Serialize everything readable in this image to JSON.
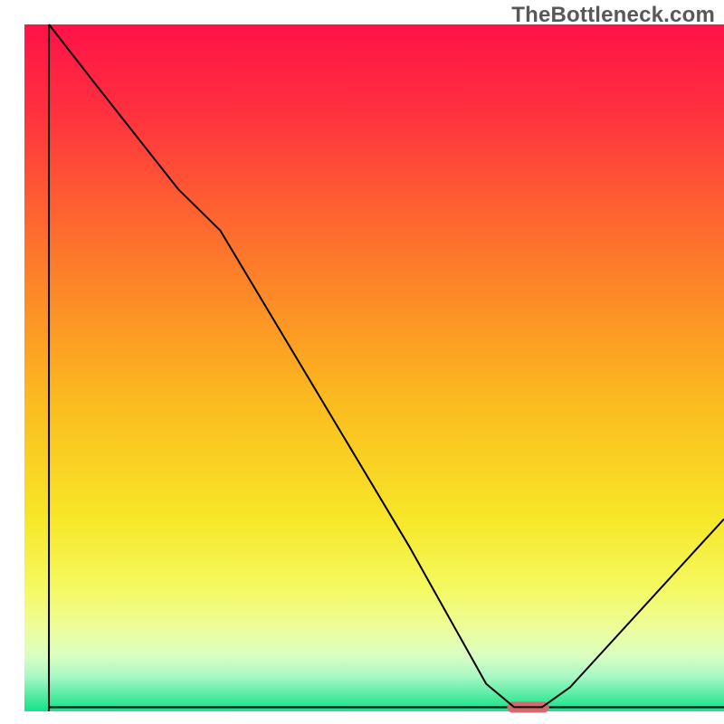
{
  "watermark": "TheBottleneck.com",
  "chart_data": {
    "type": "line",
    "title": "",
    "xlabel": "",
    "ylabel": "",
    "xlim": [
      0,
      100
    ],
    "ylim": [
      0,
      100
    ],
    "background_gradient": {
      "stops": [
        {
          "offset": 0.0,
          "color": "#ff1248"
        },
        {
          "offset": 0.12,
          "color": "#ff2f3f"
        },
        {
          "offset": 0.35,
          "color": "#fd7c2a"
        },
        {
          "offset": 0.55,
          "color": "#fbbb1f"
        },
        {
          "offset": 0.72,
          "color": "#f7e728"
        },
        {
          "offset": 0.82,
          "color": "#f5f960"
        },
        {
          "offset": 0.88,
          "color": "#edfd9b"
        },
        {
          "offset": 0.92,
          "color": "#d9fec2"
        },
        {
          "offset": 0.95,
          "color": "#a6f8c3"
        },
        {
          "offset": 0.98,
          "color": "#4bea9f"
        },
        {
          "offset": 1.0,
          "color": "#14e288"
        }
      ]
    },
    "series": [
      {
        "name": "bottleneck-curve",
        "color": "#000000",
        "x": [
          3.5,
          10.0,
          22.0,
          28.0,
          55.0,
          66.0,
          70.0,
          74.0,
          78.0,
          100.0
        ],
        "y": [
          100.0,
          91.5,
          76.0,
          70.0,
          24.0,
          4.0,
          0.6,
          0.6,
          3.5,
          28.0
        ]
      }
    ],
    "marker": {
      "name": "optimal-range-marker",
      "x_center": 72.0,
      "y_center": 0.6,
      "width": 6.0,
      "height": 1.6,
      "color": "#d56a6e"
    },
    "axes": {
      "left": {
        "x": 3.5,
        "y0": 0,
        "y1": 100
      },
      "bottom": {
        "y": 0.6,
        "x0": 3.5,
        "x1": 100
      }
    }
  }
}
